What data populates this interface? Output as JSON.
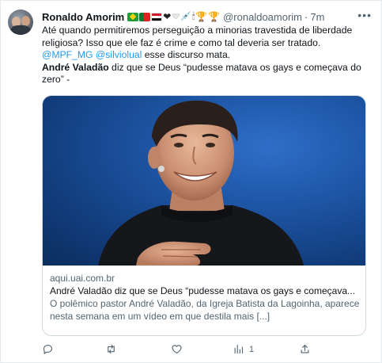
{
  "author": {
    "display_name": "Ronaldo Amorim",
    "handle": "@ronaldoamorim",
    "separator": "·",
    "time": "7m",
    "name_emojis": [
      "flag-brazil",
      "flag-portugal",
      "flag-egypt",
      "black-heart",
      "white-heart",
      "syringe",
      "lantern",
      "trophy",
      "trophy"
    ]
  },
  "tweet": {
    "line1": "Até quando permitiremos perseguição a minorias travestida de liberdade religiosa? Isso que ele faz é crime e como tal deveria ser tratado. ",
    "mention1": "@MPF_MG",
    "mention2": "@silviolual",
    "line1_end": " esse discurso mata.",
    "quote_name": "André Valadão",
    "quote_text": " diz que se Deus “pudesse matava os gays e começava do zero” -"
  },
  "card": {
    "domain": "aqui.uai.com.br",
    "title": "André Valadão diz que se Deus “pudesse matava os gays e começava...",
    "description": "O polêmico pastor André Valadão, da Igreja Batista da Lagoinha, aparece nesta semana em um vídeo em que destila mais [...]"
  },
  "actions": {
    "reply_count": "",
    "retweet_count": "",
    "like_count": "",
    "views_count": "1"
  },
  "colors": {
    "link": "#1d9bf0",
    "secondary_text": "#536471",
    "primary_text": "#0f1419",
    "border": "#cfd9de",
    "image_background": "#1e56a6"
  },
  "icons": {
    "more": "more-dots-icon",
    "reply": "reply-icon",
    "retweet": "retweet-icon",
    "like": "heart-icon",
    "views": "views-chart-icon",
    "share": "share-icon"
  }
}
